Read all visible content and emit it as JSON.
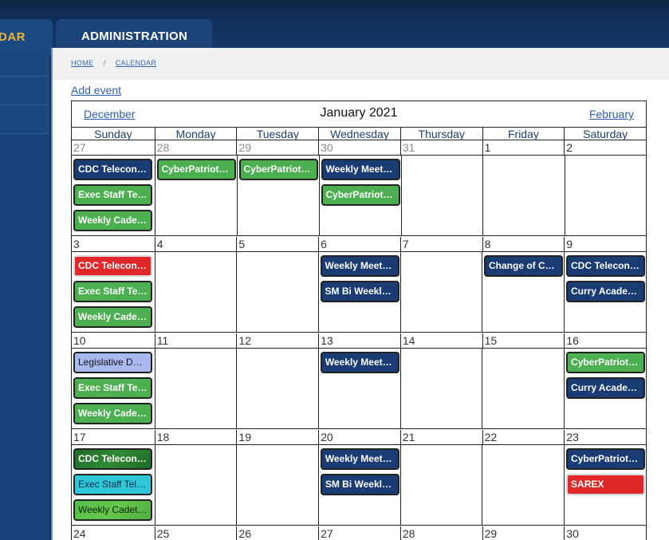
{
  "nav": {
    "tab_calendar_label": "DAR",
    "tab_admin_label": "ADMINISTRATION"
  },
  "breadcrumb": {
    "home": "HOME",
    "separator": "/",
    "calendar": "CALENDAR"
  },
  "add_event_label": "Add event",
  "calendar": {
    "prev_label": "December",
    "title": "January 2021",
    "next_label": "February",
    "weekdays": [
      "Sunday",
      "Monday",
      "Tuesday",
      "Wednesday",
      "Thursday",
      "Friday",
      "Saturday"
    ],
    "weeks": [
      {
        "days": [
          "27",
          "28",
          "29",
          "30",
          "31",
          "1",
          "2"
        ],
        "events": [
          [
            {
              "label": "CDC Teleconfer…",
              "color": "navy"
            },
            {
              "label": "Exec Staff Tele…",
              "color": "green"
            },
            {
              "label": "Weekly Cadet S…",
              "color": "green"
            }
          ],
          [
            {
              "label": "CyberPatriot Tr…",
              "color": "green"
            }
          ],
          [
            {
              "label": "CyberPatriot Tr…",
              "color": "green"
            }
          ],
          [
            {
              "label": "Weekly Meeting",
              "color": "navy"
            },
            {
              "label": "CyberPatriot Tr…",
              "color": "green"
            }
          ],
          [],
          [],
          []
        ]
      },
      {
        "days": [
          "3",
          "4",
          "5",
          "6",
          "7",
          "8",
          "9"
        ],
        "events": [
          [
            {
              "label": "CDC Teleconfer…",
              "color": "red"
            },
            {
              "label": "Exec Staff Tele…",
              "color": "green"
            },
            {
              "label": "Weekly Cadet S…",
              "color": "green"
            }
          ],
          [],
          [],
          [
            {
              "label": "Weekly Meeting",
              "color": "navy"
            },
            {
              "label": "SM Bi Weekly …",
              "color": "navy"
            }
          ],
          [],
          [
            {
              "label": "Change of Com…",
              "color": "navy"
            }
          ],
          [
            {
              "label": "CDC Teleconfer…",
              "color": "navy"
            },
            {
              "label": "Curry Academy…",
              "color": "navy"
            }
          ]
        ]
      },
      {
        "days": [
          "10",
          "11",
          "12",
          "13",
          "14",
          "15",
          "16"
        ],
        "events": [
          [
            {
              "label": "Legislative Day…",
              "color": "lavender"
            },
            {
              "label": "Exec Staff Tele…",
              "color": "green"
            },
            {
              "label": "Weekly Cadet S…",
              "color": "green"
            }
          ],
          [],
          [],
          [
            {
              "label": "Weekly Meeting",
              "color": "navy"
            }
          ],
          [],
          [],
          [
            {
              "label": "CyberPatriot Tr…",
              "color": "green"
            },
            {
              "label": "Curry Academy…",
              "color": "navy"
            }
          ]
        ]
      },
      {
        "days": [
          "17",
          "18",
          "19",
          "20",
          "21",
          "22",
          "23"
        ],
        "events": [
          [
            {
              "label": "CDC Teleconfer…",
              "color": "darkgreen"
            },
            {
              "label": "Exec Staff Tele…",
              "color": "cyan"
            },
            {
              "label": "Weekly Cadet S…",
              "color": "lime"
            }
          ],
          [],
          [],
          [
            {
              "label": "Weekly Meeting",
              "color": "navy"
            },
            {
              "label": "SM Bi Weekly …",
              "color": "navy"
            }
          ],
          [],
          [],
          [
            {
              "label": "CyberPatriot C…",
              "color": "navy"
            },
            {
              "label": "SAREX",
              "color": "red"
            }
          ]
        ]
      }
    ],
    "last_week_days": [
      "24",
      "25",
      "26",
      "27",
      "28",
      "29",
      "30"
    ]
  }
}
